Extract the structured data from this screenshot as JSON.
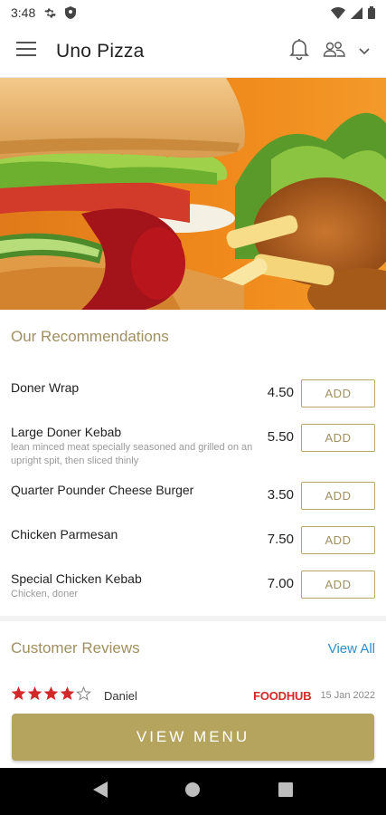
{
  "status_bar": {
    "time": "3:48"
  },
  "app_bar": {
    "title": "Uno Pizza"
  },
  "recommendations": {
    "title": "Our Recommendations",
    "items": [
      {
        "name": "Doner Wrap",
        "description": "",
        "price": "4.50",
        "add_label": "ADD"
      },
      {
        "name": "Large Doner Kebab",
        "description": "lean minced meat specially seasoned and grilled on an upright spit, then sliced thinly",
        "price": "5.50",
        "add_label": "ADD"
      },
      {
        "name": "Quarter Pounder Cheese Burger",
        "description": "",
        "price": "3.50",
        "add_label": "ADD"
      },
      {
        "name": "Chicken Parmesan",
        "description": "",
        "price": "7.50",
        "add_label": "ADD"
      },
      {
        "name": "Special Chicken Kebab",
        "description": "Chicken, doner",
        "price": "7.00",
        "add_label": "ADD"
      }
    ]
  },
  "reviews": {
    "title": "Customer Reviews",
    "view_all_label": "View All",
    "items": [
      {
        "rating": 4,
        "max_rating": 5,
        "reviewer": "Daniel",
        "source": "FOODHUB",
        "date": "15 Jan 2022"
      }
    ]
  },
  "cta": {
    "view_menu_label": "VIEW MENU"
  },
  "colors": {
    "accent": "#b5a45e",
    "accent_text": "#a08f62",
    "link": "#2f8fc6",
    "star": "#d3282a",
    "brand_red": "#d3282a"
  }
}
